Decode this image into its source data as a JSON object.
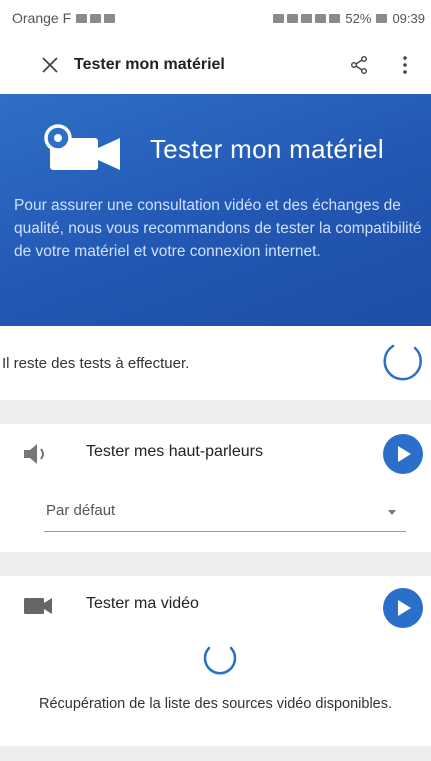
{
  "statusbar": {
    "carrier": "Orange F",
    "battery": "52%",
    "time": "09:39"
  },
  "appbar": {
    "title": "Tester mon matériel",
    "close_icon": "close-icon",
    "share_icon": "share-icon",
    "more_icon": "more-vert-icon"
  },
  "banner": {
    "title": "Tester mon matériel",
    "text": "Pour assurer une consultation vidéo et des échanges de qualité, nous vous recommandons de tester la compatibilité de votre matériel et votre connexion internet.",
    "icon": "video-camera-icon"
  },
  "status": {
    "message": "Il reste des tests à effectuer."
  },
  "speakers": {
    "label": "Tester mes haut-parleurs",
    "icon": "speaker-icon",
    "select_value": "Par défaut"
  },
  "video": {
    "label": "Tester ma vidéo",
    "icon": "video-camera-icon",
    "loading_text": "Récupération de la liste des sources vidéo disponibles."
  },
  "colors": {
    "accent": "#2a6fca",
    "banner": "#2257b3",
    "separator": "#eeeeee"
  }
}
